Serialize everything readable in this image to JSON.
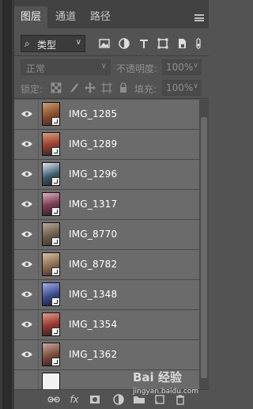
{
  "panel": {
    "tabs": [
      {
        "label": "图层",
        "active": true
      },
      {
        "label": "通道",
        "active": false
      },
      {
        "label": "路径",
        "active": false
      }
    ]
  },
  "filter": {
    "type_label": "类型",
    "icons": [
      "image-filter-icon",
      "adjustment-filter-icon",
      "type-filter-icon",
      "shape-filter-icon",
      "smart-object-filter-icon"
    ]
  },
  "blend": {
    "mode": "正常",
    "opacity_label": "不透明度:",
    "opacity_value": "100%"
  },
  "lock": {
    "label": "锁定:",
    "fill_label": "填充:",
    "fill_value": "100%"
  },
  "layers": [
    {
      "name": "IMG_1285",
      "visible": true,
      "thumb_color": "#8a4a2e"
    },
    {
      "name": "IMG_1289",
      "visible": true,
      "thumb_color": "#a04030"
    },
    {
      "name": "IMG_1296",
      "visible": true,
      "thumb_color": "#3d5a6e"
    },
    {
      "name": "IMG_1317",
      "visible": true,
      "thumb_color": "#7a3f55"
    },
    {
      "name": "IMG_8770",
      "visible": true,
      "thumb_color": "#6a5a4a"
    },
    {
      "name": "IMG_8782",
      "visible": true,
      "thumb_color": "#8a6a50"
    },
    {
      "name": "IMG_1348",
      "visible": true,
      "thumb_color": "#3a4a8a"
    },
    {
      "name": "IMG_1354",
      "visible": true,
      "thumb_color": "#9a3a30"
    },
    {
      "name": "IMG_1362",
      "visible": true,
      "thumb_color": "#7a4a3a"
    },
    {
      "name": "",
      "visible": false,
      "thumb_color": "#f2f2f2"
    }
  ],
  "bottom_icons": [
    "link-layers-icon",
    "fx-icon",
    "mask-icon",
    "adjustment-layer-icon",
    "group-folder-icon",
    "new-layer-icon",
    "trash-icon"
  ],
  "watermark": {
    "brand": "Bai 经验",
    "url": "jingyan.baidu.com"
  }
}
